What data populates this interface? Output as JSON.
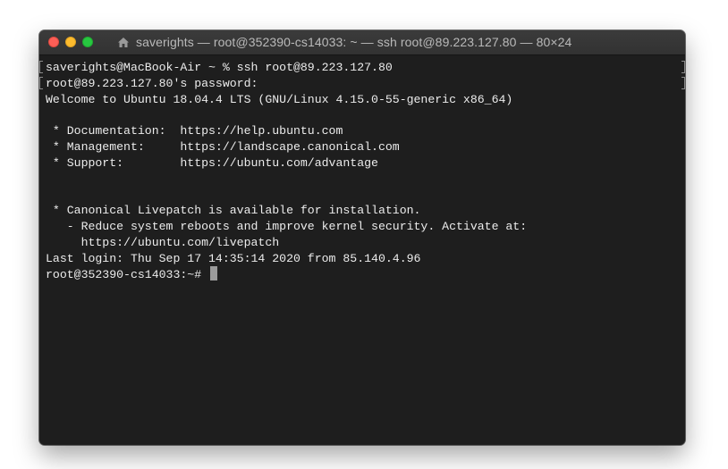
{
  "window": {
    "title": "saverights — root@352390-cs14033: ~ — ssh root@89.223.127.80 — 80×24",
    "title_icon": "home-folder-icon",
    "traffic_lights": {
      "close": "#fc5f57",
      "minimize": "#fdbc2e",
      "zoom": "#27c840"
    }
  },
  "terminal": {
    "lines": [
      "saverights@MacBook-Air ~ % ssh root@89.223.127.80",
      "root@89.223.127.80's password:",
      "Welcome to Ubuntu 18.04.4 LTS (GNU/Linux 4.15.0-55-generic x86_64)",
      "",
      " * Documentation:  https://help.ubuntu.com",
      " * Management:     https://landscape.canonical.com",
      " * Support:        https://ubuntu.com/advantage",
      "",
      "",
      " * Canonical Livepatch is available for installation.",
      "   - Reduce system reboots and improve kernel security. Activate at:",
      "     https://ubuntu.com/livepatch",
      "Last login: Thu Sep 17 14:35:14 2020 from 85.140.4.96"
    ],
    "prompt": "root@352390-cs14033:~# "
  }
}
